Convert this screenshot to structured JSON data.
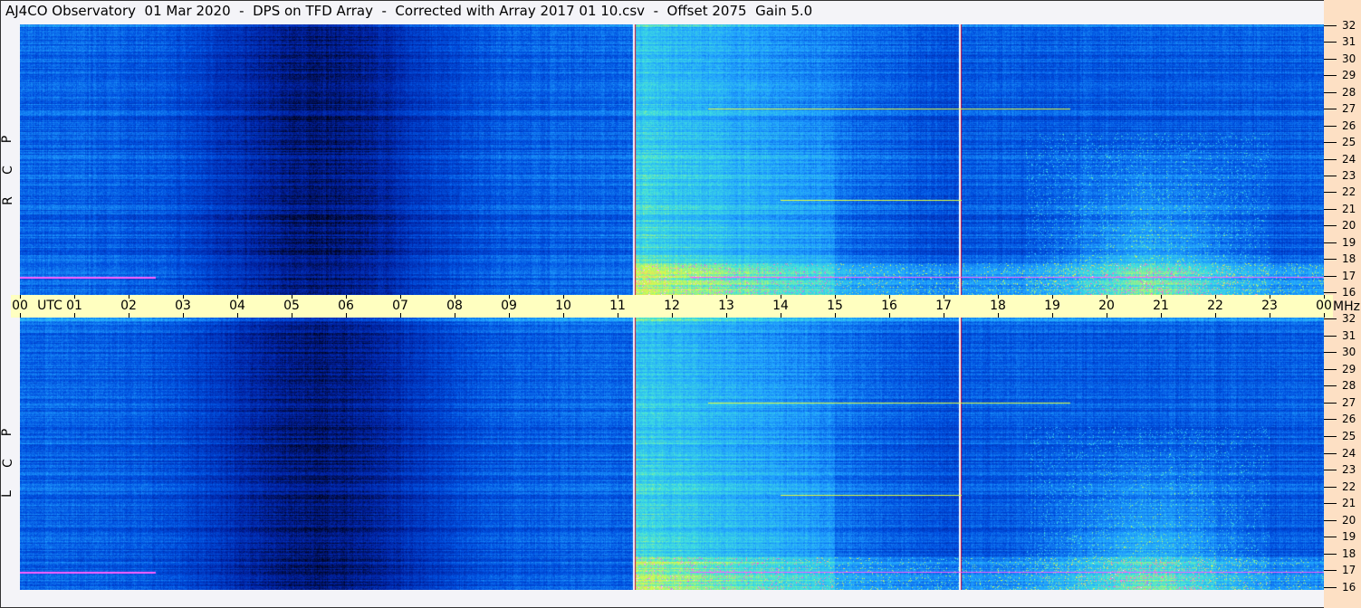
{
  "title": "AJ4CO Observatory  01 Mar 2020  -  DPS on TFD Array  -  Corrected with Array 2017 01 10.csv  -  Offset 2075  Gain 5.0",
  "chart_data": {
    "type": "heatmap",
    "title": "AJ4CO Observatory  01 Mar 2020  -  DPS on TFD Array  -  Corrected with Array 2017 01 10.csv  -  Offset 2075  Gain 5.0",
    "xlabel": "UTC",
    "ylabel": "MHz",
    "x_ticks": [
      "00",
      "01",
      "02",
      "03",
      "04",
      "05",
      "06",
      "07",
      "08",
      "09",
      "10",
      "11",
      "12",
      "13",
      "14",
      "15",
      "16",
      "17",
      "18",
      "19",
      "20",
      "21",
      "22",
      "23",
      "00"
    ],
    "xlim": [
      0,
      24
    ],
    "y_ticks": [
      32,
      31,
      30,
      29,
      28,
      27,
      26,
      25,
      24,
      23,
      22,
      21,
      20,
      19,
      18,
      17,
      16
    ],
    "ylim": [
      16,
      32
    ],
    "panels": [
      {
        "name": "R C P",
        "polarization_letters": [
          "R",
          "C",
          "P"
        ]
      },
      {
        "name": "L C P",
        "polarization_letters": [
          "L",
          "C",
          "P"
        ]
      }
    ],
    "colormap": [
      "#000010",
      "#0020a0",
      "#0050e0",
      "#20a0ff",
      "#40e0e0",
      "#e0ff40",
      "#ff40ff",
      "#ffffff"
    ],
    "dark_period_utc": [
      3,
      8
    ],
    "marker_lines_utc": [
      11.3,
      17.3
    ]
  }
}
